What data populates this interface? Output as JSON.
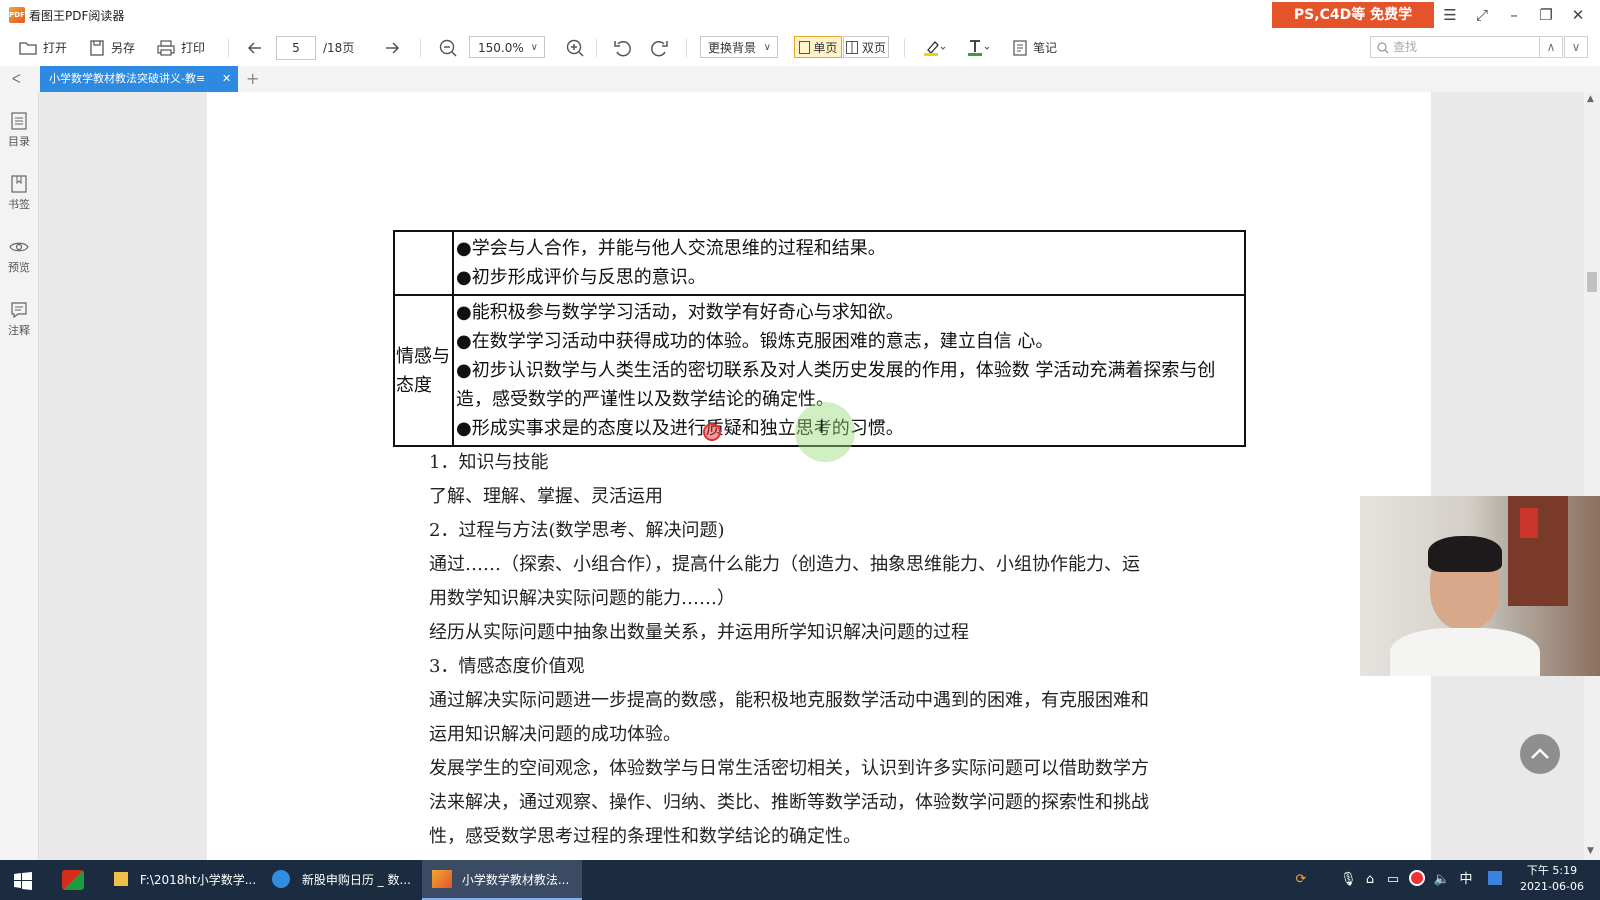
{
  "app": {
    "title": "看图王PDF阅读器",
    "logo_text": "PDF",
    "ad_banner": "PS,C4D等 免费学"
  },
  "toolbar": {
    "open": "打开",
    "save_as": "另存",
    "print": "打印",
    "current_page": "5",
    "total_pages": "/18页",
    "zoom": "150.0%",
    "background": "更换背景",
    "single_page": "单页",
    "double_page": "双页",
    "note": "笔记",
    "search_placeholder": "查找"
  },
  "tabs": {
    "active": "小学数学教材教法突破讲义-教≡"
  },
  "sidebar": {
    "items": [
      "目录",
      "书签",
      "预览",
      "注释"
    ]
  },
  "document": {
    "table": {
      "row1": [
        "●学会与人合作，并能与他人交流思维的过程和结果。",
        "●初步形成评价与反思的意识。"
      ],
      "row2_category": "情感与态度",
      "row2": [
        "●能积极参与数学学习活动，对数学有好奇心与求知欲。",
        "●在数学学习活动中获得成功的体验。锻炼克服困难的意志，建立自信 心。",
        "●初步认识数学与人类生活的密切联系及对人类历史发展的作用，体验数 学活动充满着探索与创造，感受数学的严谨性以及数学结论的确定性。",
        "●形成实事求是的态度以及进行质疑和独立思考的习惯。"
      ]
    },
    "paragraphs": [
      "1．知识与技能",
      "了解、理解、掌握、灵活运用",
      "2．过程与方法(数学思考、解决问题)",
      "通过……（探索、小组合作），提高什么能力（创造力、抽象思维能力、小组协作能力、运",
      "用数学知识解决实际问题的能力……）",
      "经历从实际问题中抽象出数量关系，并运用所学知识解决问题的过程",
      "3．情感态度价值观",
      "通过解决实际问题进一步提高的数感，能积极地克服数学活动中遇到的困难，有克服困难和",
      "运用知识解决问题的成功体验。",
      "发展学生的空间观念，体验数学与日常生活密切相关，认识到许多实际问题可以借助数学方",
      "法来解决，通过观察、操作、归纳、类比、推断等数学活动，体验数学问题的探索性和挑战",
      "性，感受数学思考过程的条理性和数学结论的确定性。"
    ]
  },
  "taskbar": {
    "items": [
      "F:\\2018ht小学数学...",
      "新股申购日历 _ 数...",
      "小学数学教材教法..."
    ],
    "ime": "中",
    "time_period": "下午 5:19",
    "date": "2021-06-06"
  },
  "colors": {
    "accent": "#2d8ae0",
    "ad": "#e5532b",
    "taskbar": "#1c2c40",
    "highlight": "#fff2c8"
  }
}
